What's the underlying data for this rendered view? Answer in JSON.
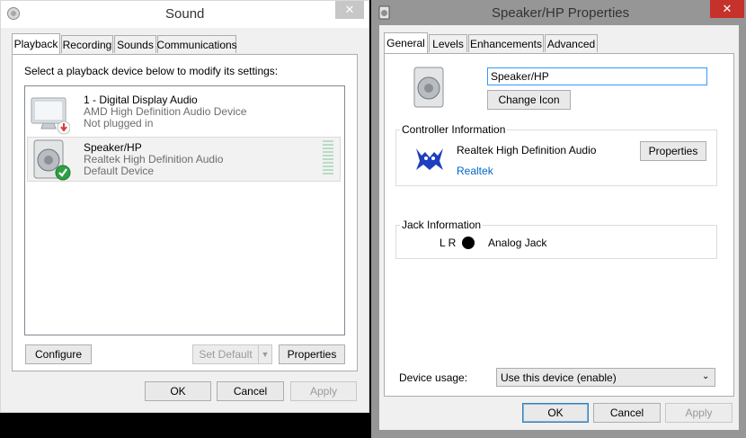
{
  "sound_window": {
    "title": "Sound",
    "close_label": "✕",
    "tabs": [
      "Playback",
      "Recording",
      "Sounds",
      "Communications"
    ],
    "instruction": "Select a playback device below to modify its settings:",
    "devices": [
      {
        "name": "1 - Digital Display Audio",
        "driver": "AMD High Definition Audio Device",
        "status": "Not plugged in"
      },
      {
        "name": "Speaker/HP",
        "driver": "Realtek High Definition Audio",
        "status": "Default Device"
      }
    ],
    "buttons": {
      "configure": "Configure",
      "set_default": "Set Default",
      "properties": "Properties",
      "ok": "OK",
      "cancel": "Cancel",
      "apply": "Apply"
    }
  },
  "props_window": {
    "title": "Speaker/HP Properties",
    "close_label": "✕",
    "tabs": [
      "General",
      "Levels",
      "Enhancements",
      "Advanced"
    ],
    "device_name_value": "Speaker/HP",
    "change_icon_label": "Change Icon",
    "controller": {
      "title": "Controller Information",
      "name": "Realtek High Definition Audio",
      "vendor_link": "Realtek",
      "properties_label": "Properties"
    },
    "jack": {
      "title": "Jack Information",
      "channels": "L R",
      "type": "Analog Jack"
    },
    "device_usage": {
      "label": "Device usage:",
      "selected": "Use this device (enable)"
    },
    "buttons": {
      "ok": "OK",
      "cancel": "Cancel",
      "apply": "Apply"
    }
  },
  "colors": {
    "close_red": "#c7312b",
    "link_blue": "#0066cc",
    "selection_blue": "#3399ff",
    "check_green": "#2ea043",
    "unplugged_red": "#d83b3b"
  }
}
